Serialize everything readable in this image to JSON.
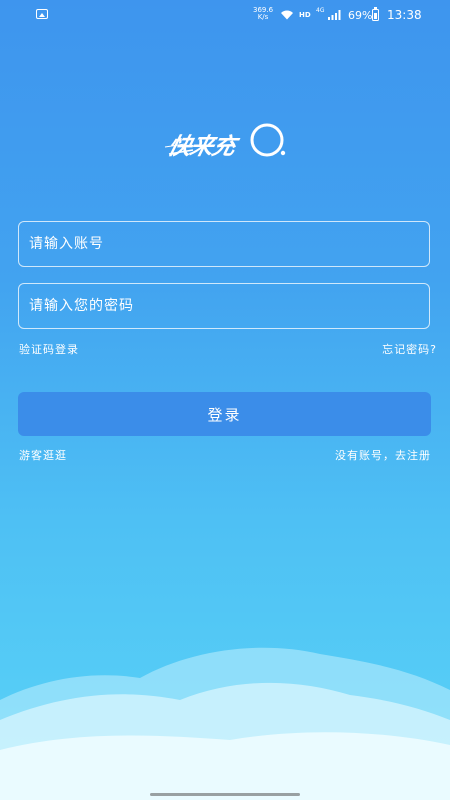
{
  "status_bar": {
    "net_speed_value": "369.6",
    "net_speed_unit": "K/s",
    "hd": "HD",
    "network": "4G",
    "battery": "69%",
    "time": "13:38"
  },
  "logo": {
    "text": "快来充"
  },
  "login": {
    "account_placeholder": "请输入账号",
    "password_placeholder": "请输入您的密码",
    "sms_login": "验证码登录",
    "forgot_password": "忘记密码?",
    "login_button": "登录",
    "guest": "游客逛逛",
    "register": "没有账号，去注册"
  },
  "colors": {
    "background_top": "#3e95ee",
    "background_bottom": "#5ad4f7",
    "button": "#3b8de9"
  }
}
